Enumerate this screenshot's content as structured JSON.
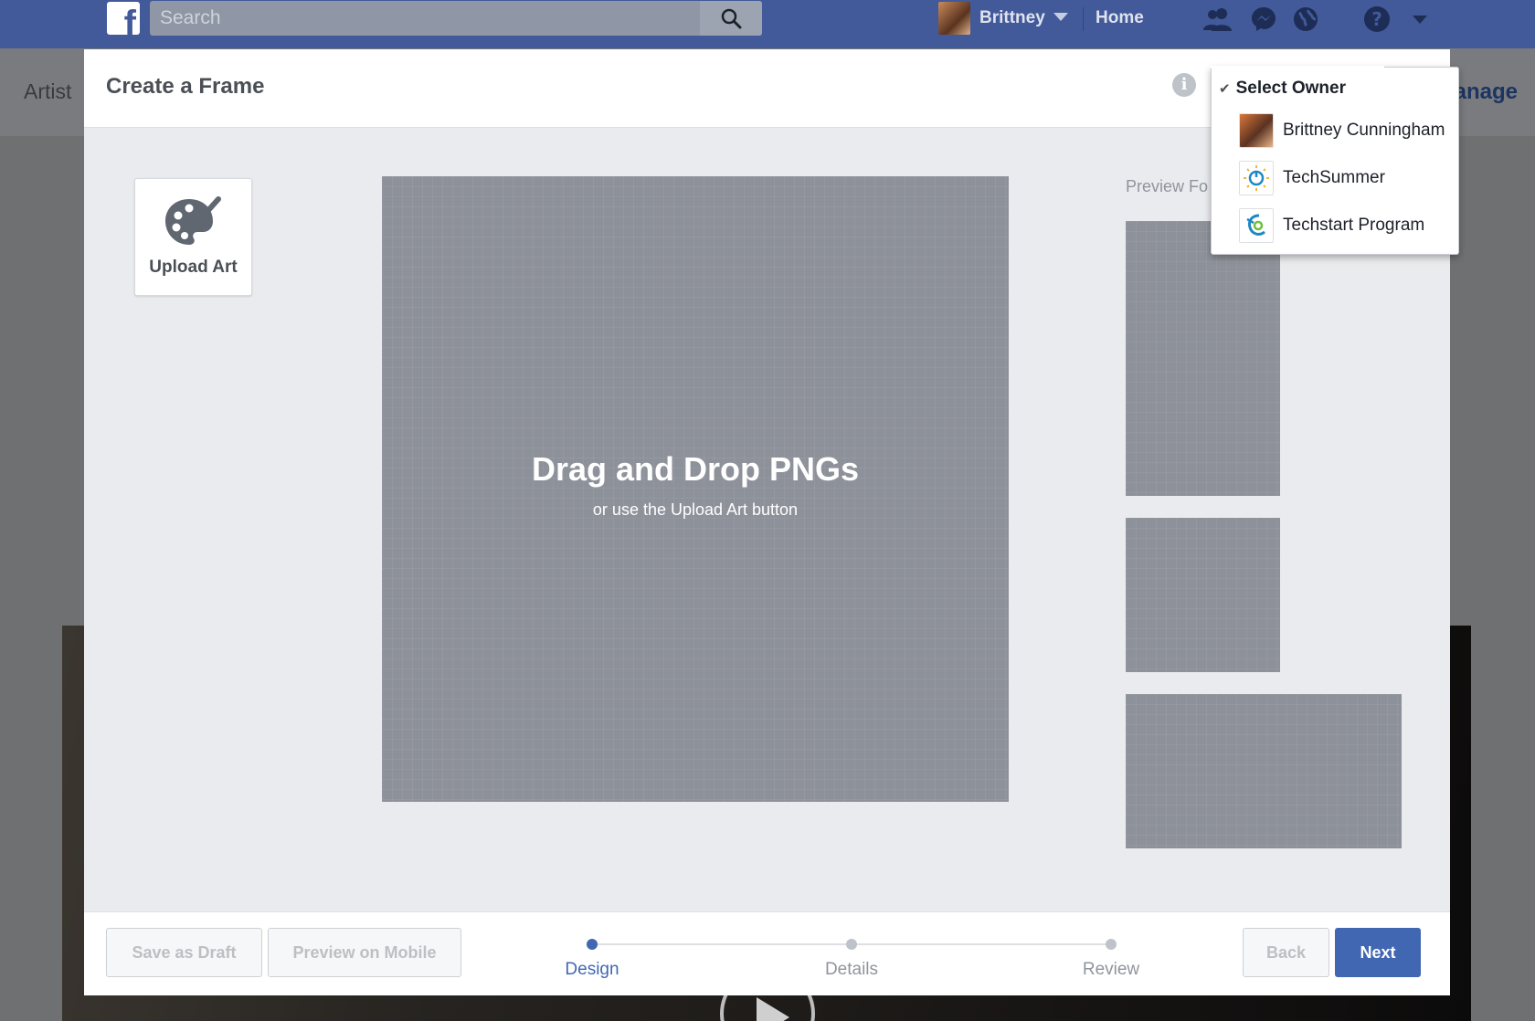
{
  "topbar": {
    "search_placeholder": "Search",
    "user_name": "Brittney",
    "home_label": "Home"
  },
  "background": {
    "left_text": "Artist",
    "right_text": "lanage"
  },
  "modal": {
    "title": "Create a Frame",
    "upload_art_label": "Upload Art",
    "dropzone_title": "Drag and Drop PNGs",
    "dropzone_subtitle": "or use the Upload Art button",
    "preview_label": "Preview Fo"
  },
  "footer": {
    "save_draft_label": "Save as Draft",
    "preview_mobile_label": "Preview on Mobile",
    "back_label": "Back",
    "next_label": "Next",
    "steps": [
      {
        "label": "Design",
        "active": true
      },
      {
        "label": "Details",
        "active": false
      },
      {
        "label": "Review",
        "active": false
      }
    ]
  },
  "owner_menu": {
    "header": "Select Owner",
    "items": [
      {
        "name": "Brittney Cunningham",
        "icon": "profile-photo"
      },
      {
        "name": "TechSummer",
        "icon": "techsummer-logo"
      },
      {
        "name": "Techstart Program",
        "icon": "techstart-logo"
      }
    ]
  },
  "colors": {
    "fb_blue": "#42599a",
    "primary_button": "#4267b2",
    "canvas_gray": "#8d9199"
  }
}
